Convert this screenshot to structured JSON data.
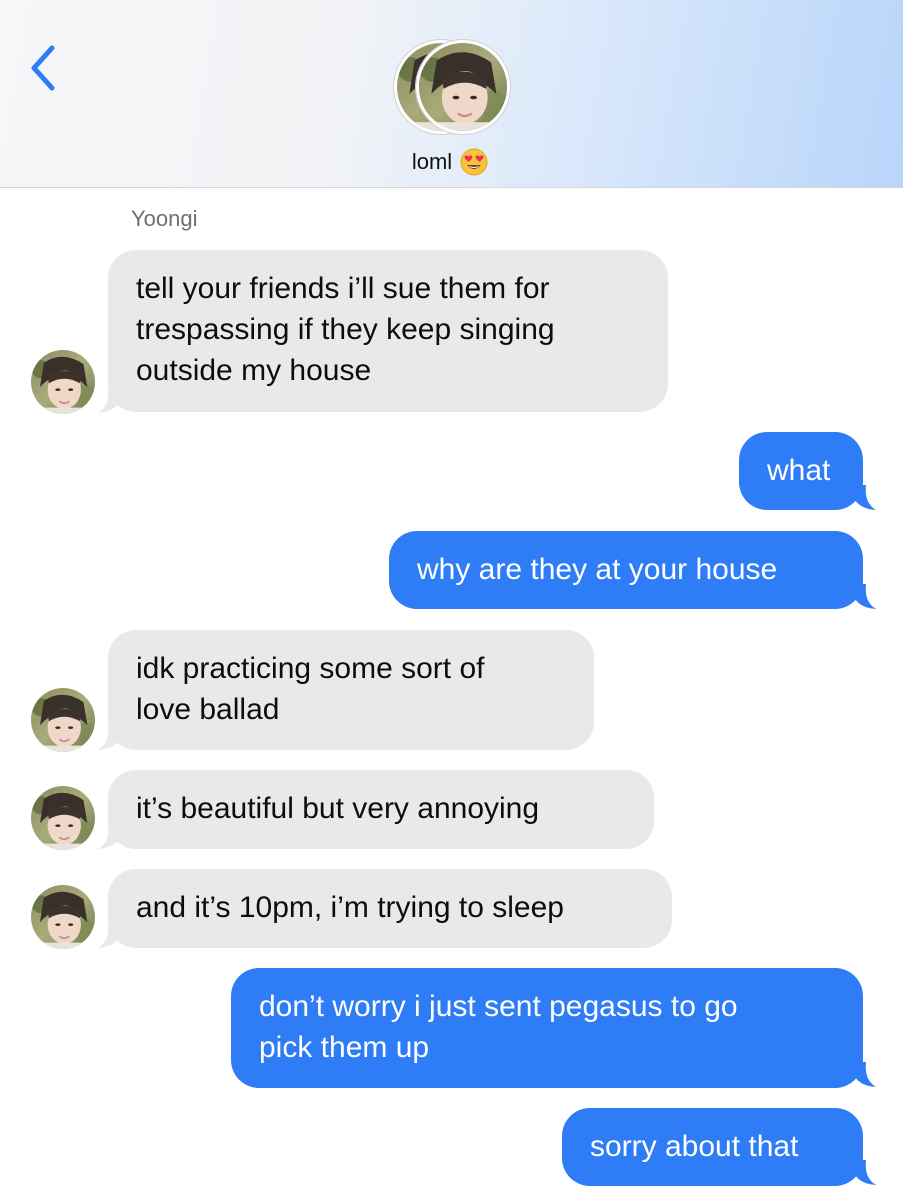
{
  "header": {
    "contact_name": "loml",
    "emoji": "heart-eyes-emoji",
    "back_icon": "chevron-left-icon",
    "accent": "#2e7cf6"
  },
  "conversation": {
    "sender_name": "Yoongi",
    "messages": [
      {
        "from": "them",
        "text": "tell your friends i’ll sue them for\ntrespassing if they keep singing\noutside my house"
      },
      {
        "from": "me",
        "text": "what"
      },
      {
        "from": "me",
        "text": "why are they at your house"
      },
      {
        "from": "them",
        "text": "idk practicing some sort of\nlove ballad"
      },
      {
        "from": "them",
        "text": "it’s beautiful but very annoying"
      },
      {
        "from": "them",
        "text": "and it’s 10pm, i’m trying to sleep"
      },
      {
        "from": "me",
        "text": "don’t worry i just sent pegasus to go\npick them up"
      },
      {
        "from": "me",
        "text": "sorry about that"
      }
    ]
  },
  "colors": {
    "outgoing_bubble": "#2e7cf6",
    "incoming_bubble": "#e9e9eb"
  }
}
